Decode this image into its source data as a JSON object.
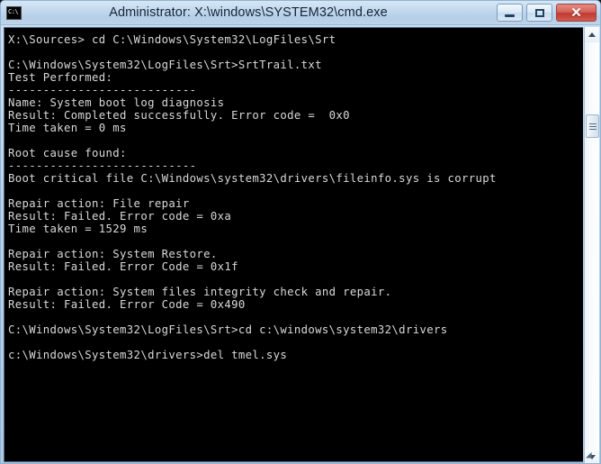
{
  "window": {
    "title": "Administrator: X:\\windows\\SYSTEM32\\cmd.exe",
    "icon_label": "C:\\",
    "icon_name": "cmd-console-icon",
    "background_color": "#000000",
    "text_color": "#d9d9d9",
    "titlebar_color": "#b9d1e8",
    "close_color": "#c0392f"
  },
  "controls": {
    "minimize_label": "–",
    "maximize_label": "□",
    "close_label": "✕"
  },
  "scrollbar": {
    "up_arrow_label": "▲",
    "down_arrow_label": "▼",
    "thumb_label": "scroll-thumb"
  },
  "resize": {
    "grip_label": "◢"
  },
  "console": {
    "lines": [
      "X:\\Sources> cd C:\\Windows\\System32\\LogFiles\\Srt",
      "",
      "C:\\Windows\\System32\\LogFiles\\Srt>SrtTrail.txt",
      "Test Performed:",
      "---------------------------",
      "Name: System boot log diagnosis",
      "Result: Completed successfully. Error code =  0x0",
      "Time taken = 0 ms",
      "",
      "Root cause found:",
      "---------------------------",
      "Boot critical file C:\\Windows\\system32\\drivers\\fileinfo.sys is corrupt",
      "",
      "Repair action: File repair",
      "Result: Failed. Error code = 0xa",
      "Time taken = 1529 ms",
      "",
      "Repair action: System Restore.",
      "Result: Failed. Error Code = 0x1f",
      "",
      "Repair action: System files integrity check and repair.",
      "Result: Failed. Error Code = 0x490",
      "",
      "C:\\Windows\\System32\\LogFiles\\Srt>cd c:\\windows\\system32\\drivers",
      "",
      "c:\\Windows\\System32\\drivers>del tmel.sys",
      ""
    ]
  }
}
